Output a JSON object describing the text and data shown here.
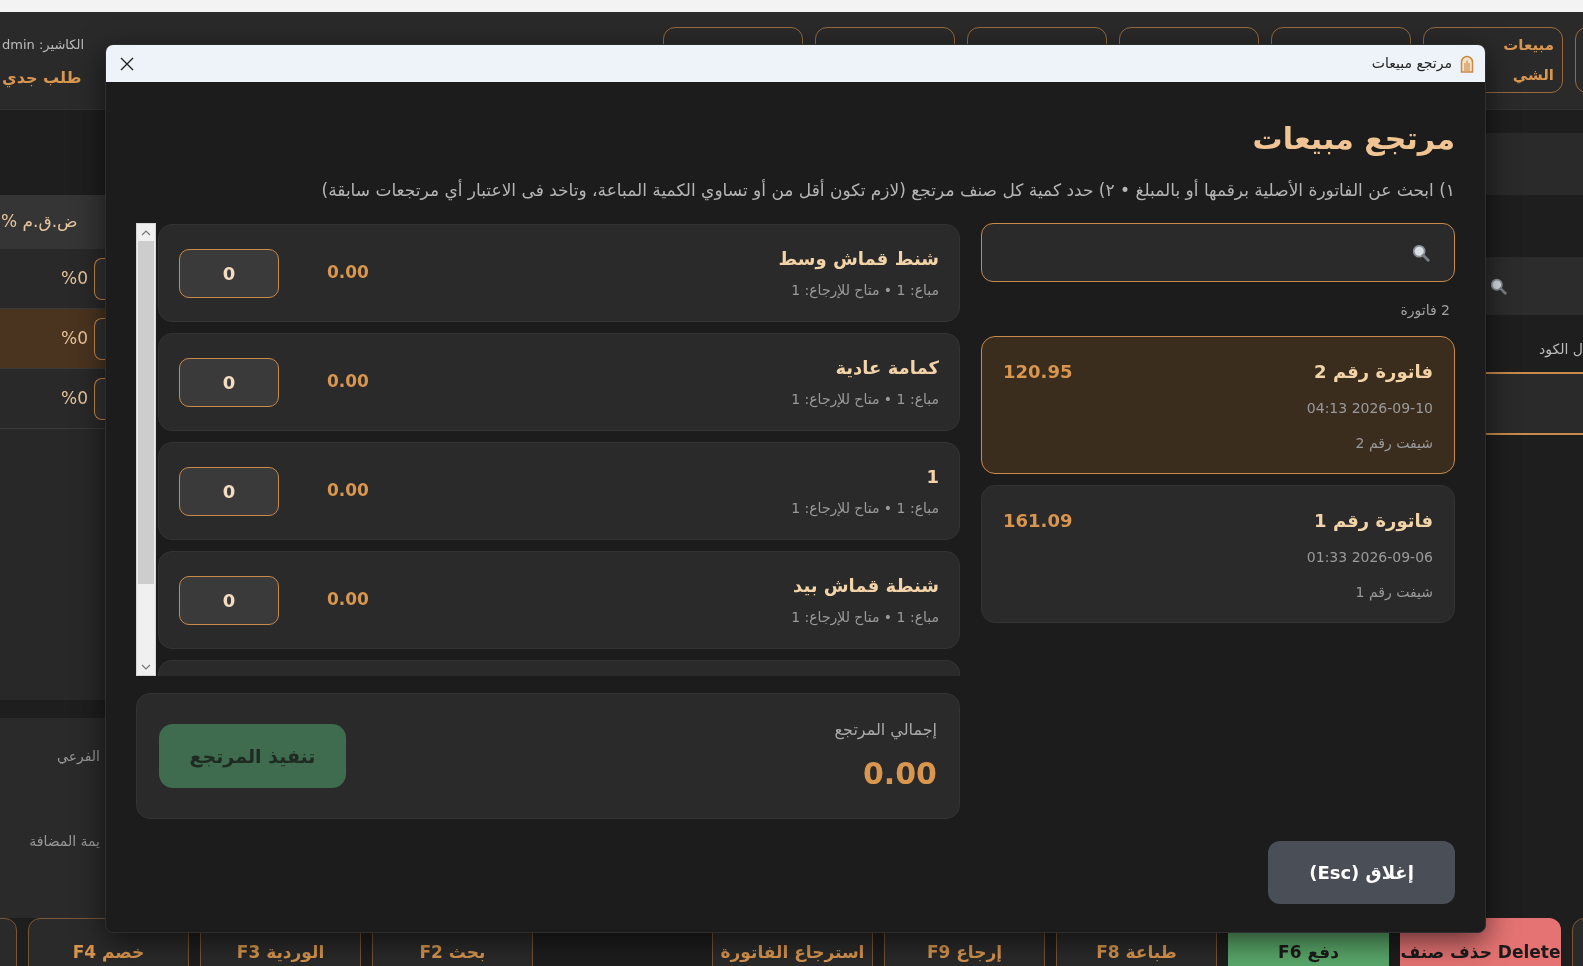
{
  "app_header": {
    "cashier": "الكاشير: dmin",
    "new_order": "طلب جدي",
    "top_buttons": [
      {
        "label": "مبيعات الشي"
      }
    ]
  },
  "cart_table": {
    "columns": [
      {
        "label": "ض.ق.م %"
      }
    ],
    "rows": [
      {
        "vat": "%0",
        "selected": false
      },
      {
        "vat": "%0",
        "selected": true
      },
      {
        "vat": "%0",
        "selected": false
      }
    ]
  },
  "totals": [
    {
      "label": "الفرعي"
    },
    {
      "label": "يمة المضافة"
    }
  ],
  "product_panel": {
    "code_label": "ل الكود"
  },
  "bottom_toolbar": {
    "right_group": [
      {
        "label": "حذف صنف Delete",
        "kind": "danger"
      },
      {
        "label": "F6 دفع",
        "kind": "pay"
      },
      {
        "label": "F8 طباعة",
        "kind": "outline"
      },
      {
        "label": "F9 إرجاع",
        "kind": "outline"
      },
      {
        "label": "استرجاع الفاتورة",
        "kind": "outline"
      }
    ],
    "left_group": [
      {
        "label": "F2 بحث",
        "kind": "outline"
      },
      {
        "label": "F3 الوردية",
        "kind": "outline"
      },
      {
        "label": "F4 خصم",
        "kind": "outline"
      }
    ]
  },
  "dialog": {
    "title": "مرتجع مبيعات",
    "heading": "مرتجع مبيعات",
    "instructions": "١) ابحث عن الفاتورة الأصلية برقمها أو بالمبلغ • ٢) حدد كمية كل صنف مرتجع (لازم تكون أقل من أو تساوي الكمية المباعة، وتاخد فى الاعتبار أي مرتجعات سابقة)",
    "invoice_count": "2 فاتورة",
    "invoices": [
      {
        "title": "فاتورة رقم 2",
        "amount": "120.95",
        "date": "2026-09-10 04:13",
        "shift": "شيفت رقم 2",
        "selected": true
      },
      {
        "title": "فاتورة رقم 1",
        "amount": "161.09",
        "date": "2026-09-06 01:33",
        "shift": "شيفت رقم 1",
        "selected": false
      }
    ],
    "items": [
      {
        "name": "شنط قماش وسط",
        "meta": "مباع: 1 • متاح للإرجاع: 1",
        "line_total": "0.00",
        "quantity": "0"
      },
      {
        "name": "كمامة عادية",
        "meta": "مباع: 1 • متاح للإرجاع: 1",
        "line_total": "0.00",
        "quantity": "0"
      },
      {
        "name": "1",
        "meta": "مباع: 1 • متاح للإرجاع: 1",
        "line_total": "0.00",
        "quantity": "0"
      },
      {
        "name": "شنطة قماش بيد",
        "meta": "مباع: 1 • متاح للإرجاع: 1",
        "line_total": "0.00",
        "quantity": "0"
      }
    ],
    "total": {
      "label": "إجمالي المرتجع",
      "value": "0.00"
    },
    "submit": {
      "label": "تنفيذ المرتجع",
      "disabled": true
    },
    "close": {
      "label": "إغلاق (Esc)"
    }
  }
}
